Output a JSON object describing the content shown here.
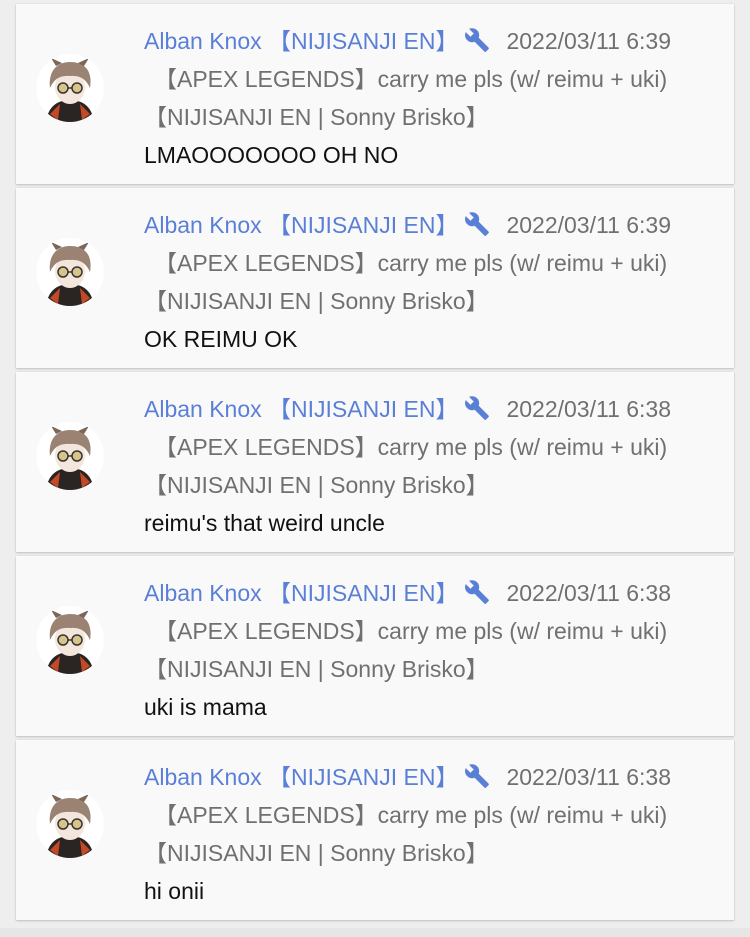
{
  "comments": [
    {
      "author": "Alban Knox 【NIJISANJI EN】",
      "badge_icon": "wrench-icon",
      "timestamp": "2022/03/11 6:39",
      "video_title": "【APEX LEGENDS】carry me pls (w/ reimu + uki)【NIJISANJI EN | Sonny Brisko】",
      "message": "LMAOOOOOOO OH NO"
    },
    {
      "author": "Alban Knox 【NIJISANJI EN】",
      "badge_icon": "wrench-icon",
      "timestamp": "2022/03/11 6:39",
      "video_title": "【APEX LEGENDS】carry me pls (w/ reimu + uki)【NIJISANJI EN | Sonny Brisko】",
      "message": "OK REIMU OK"
    },
    {
      "author": "Alban Knox 【NIJISANJI EN】",
      "badge_icon": "wrench-icon",
      "timestamp": "2022/03/11 6:38",
      "video_title": "【APEX LEGENDS】carry me pls (w/ reimu + uki)【NIJISANJI EN | Sonny Brisko】",
      "message": "reimu's that weird uncle"
    },
    {
      "author": "Alban Knox 【NIJISANJI EN】",
      "badge_icon": "wrench-icon",
      "timestamp": "2022/03/11 6:38",
      "video_title": "【APEX LEGENDS】carry me pls (w/ reimu + uki)【NIJISANJI EN | Sonny Brisko】",
      "message": "uki is mama"
    },
    {
      "author": "Alban Knox 【NIJISANJI EN】",
      "badge_icon": "wrench-icon",
      "timestamp": "2022/03/11 6:38",
      "video_title": "【APEX LEGENDS】carry me pls (w/ reimu + uki)【NIJISANJI EN | Sonny Brisko】",
      "message": "hi onii"
    }
  ],
  "colors": {
    "author": "#5a7fd6",
    "meta_text": "#707070",
    "message_text": "#111111",
    "card_bg": "#f9f9f9",
    "page_bg": "#eeeeee"
  }
}
